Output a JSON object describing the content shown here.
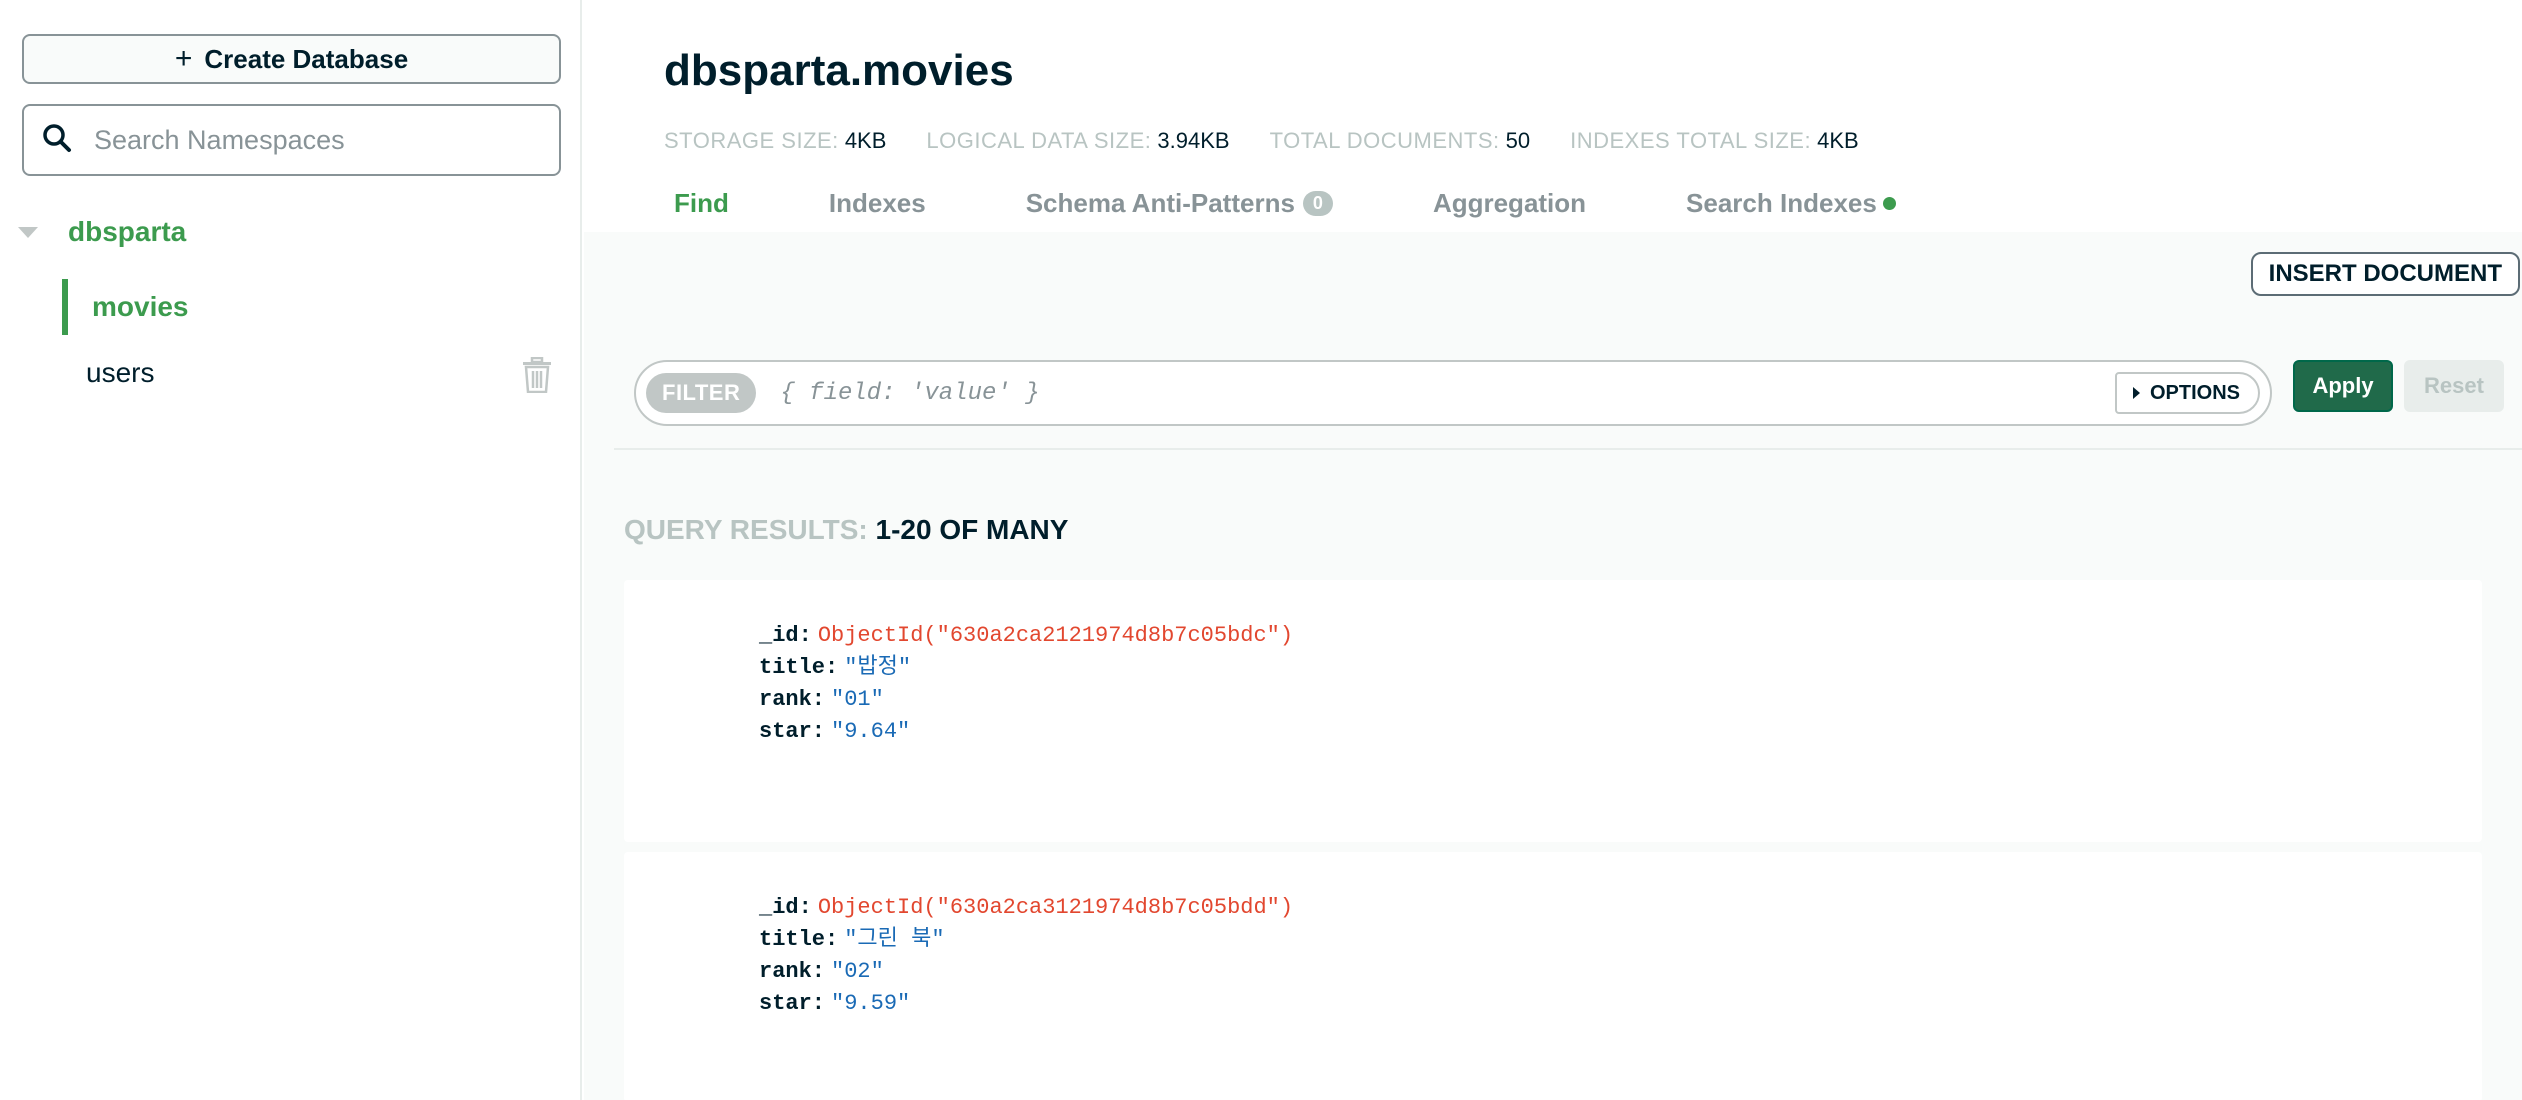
{
  "sidebar": {
    "create_button_icon": "plus-icon",
    "create_button_label": "Create Database",
    "search_placeholder": "Search Namespaces",
    "database": {
      "name": "dbsparta"
    },
    "collections": [
      {
        "name": "movies",
        "active": true
      },
      {
        "name": "users",
        "active": false
      }
    ]
  },
  "header": {
    "namespace": "dbsparta.movies",
    "stats": [
      {
        "label": "STORAGE SIZE:",
        "value": "4KB"
      },
      {
        "label": "LOGICAL DATA SIZE:",
        "value": "3.94KB"
      },
      {
        "label": "TOTAL DOCUMENTS:",
        "value": "50"
      },
      {
        "label": "INDEXES TOTAL SIZE:",
        "value": "4KB"
      }
    ],
    "tabs": [
      {
        "label": "Find",
        "active": true
      },
      {
        "label": "Indexes"
      },
      {
        "label": "Schema Anti-Patterns",
        "badge": "0"
      },
      {
        "label": "Aggregation"
      },
      {
        "label": "Search Indexes",
        "dot": true
      }
    ]
  },
  "toolbar": {
    "insert_label": "INSERT DOCUMENT",
    "filter_label": "FILTER",
    "filter_placeholder": "{ field: 'value' }",
    "options_label": "OPTIONS",
    "apply_label": "Apply",
    "reset_label": "Reset"
  },
  "results": {
    "label_prefix": "QUERY RESULTS:",
    "label_range": "1-20 OF MANY",
    "documents": [
      {
        "_id": "ObjectId(\"630a2ca2121974d8b7c05bdc\")",
        "title": "\"밥정\"",
        "rank": "\"01\"",
        "star": "\"9.64\""
      },
      {
        "_id": "ObjectId(\"630a2ca3121974d8b7c05bdd\")",
        "title": "\"그린 북\"",
        "rank": "\"02\"",
        "star": "\"9.59\""
      }
    ]
  },
  "field_keys": {
    "id": "_id:",
    "title": "title:",
    "rank": "rank:",
    "star": "star:"
  },
  "colors": {
    "accent_green": "#3c9b4e",
    "apply_green": "#206a4a",
    "objectid_red": "#e2472f",
    "string_blue": "#1a6ab5"
  }
}
